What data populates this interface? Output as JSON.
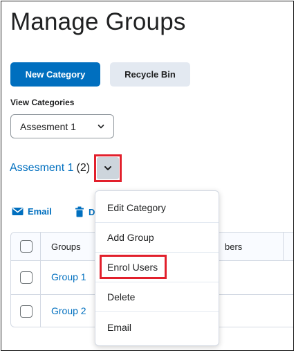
{
  "page": {
    "title": "Manage Groups"
  },
  "toolbar": {
    "new_category": "New Category",
    "recycle_bin": "Recycle Bin"
  },
  "view": {
    "label": "View Categories",
    "selected": "Assesment 1"
  },
  "category": {
    "name": "Assesment 1",
    "count": "(2)"
  },
  "actions": {
    "email": "Email",
    "delete_partial": "D"
  },
  "table": {
    "headers": {
      "groups": "Groups",
      "members_partial": "bers"
    },
    "rows": [
      {
        "name": "Group 1"
      },
      {
        "name": "Group 2"
      }
    ]
  },
  "menu": {
    "items": [
      {
        "label": "Edit Category"
      },
      {
        "label": "Add Group"
      },
      {
        "label": "Enrol Users"
      },
      {
        "label": "Delete"
      },
      {
        "label": "Email"
      }
    ]
  },
  "colors": {
    "accent": "#006fbf",
    "highlight": "#e2202c",
    "secondary_bg": "#e3e9f1"
  },
  "icons": {
    "email": "envelope-icon",
    "delete": "trash-icon",
    "expand": "chevron-down-icon"
  }
}
